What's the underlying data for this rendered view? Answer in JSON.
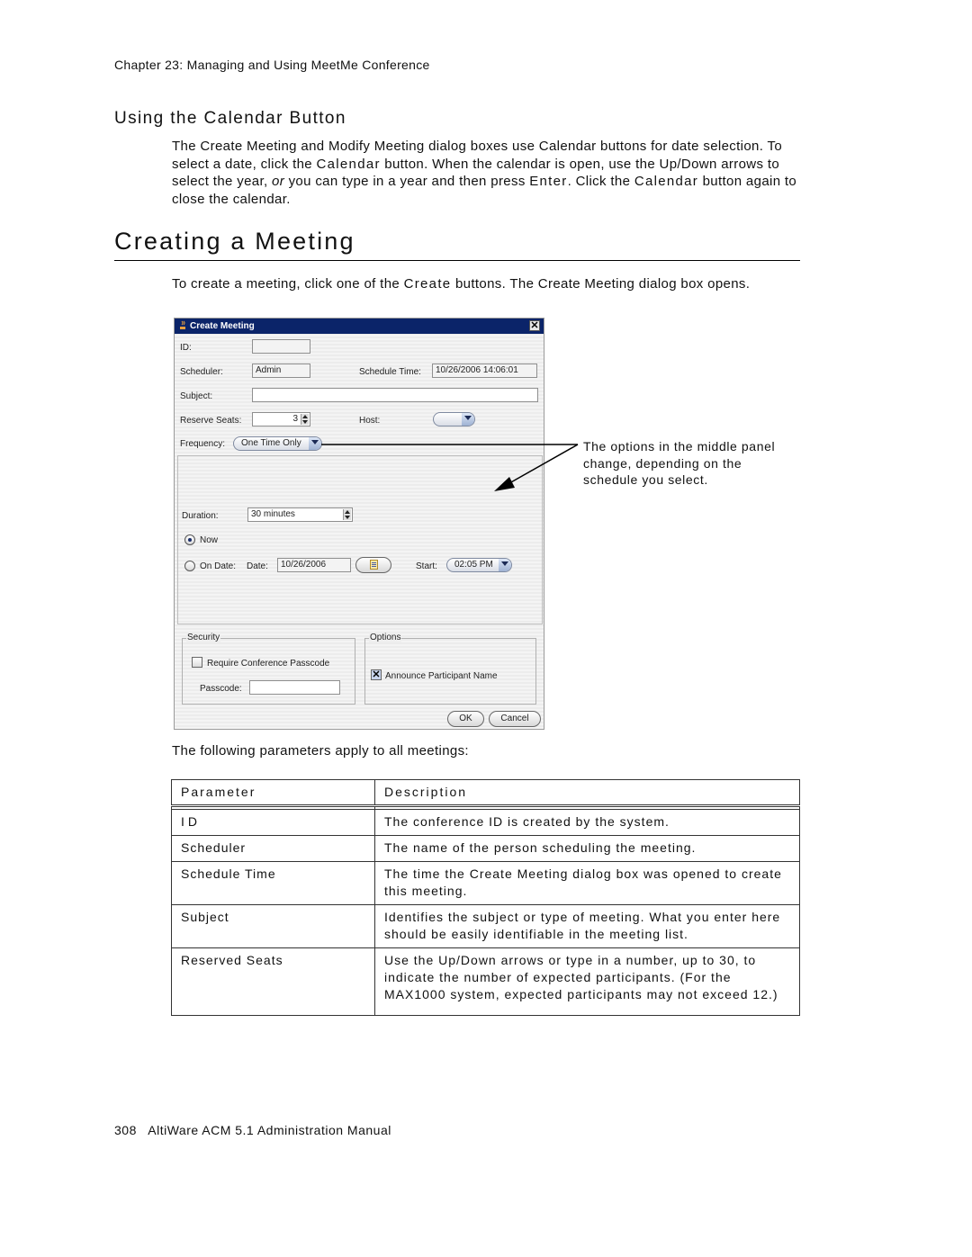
{
  "header": {
    "chapter": "Chapter 23:  Managing and Using MeetMe Conference"
  },
  "section_calendar": {
    "title": "Using the Calendar Button",
    "paragraph": [
      {
        "text": "The Create Meeting and Modify Meeting dialog boxes use Calendar buttons for date selection. To select a date, click the "
      },
      {
        "text": "Calendar",
        "style": "code"
      },
      {
        "text": " button. When the calendar is open, use the Up/Down arrows to select the year, "
      },
      {
        "text": "or",
        "style": "italic"
      },
      {
        "text": " you can type in a year and then press "
      },
      {
        "text": "Enter",
        "style": "code"
      },
      {
        "text": ". Click the "
      },
      {
        "text": "Calendar",
        "style": "code"
      },
      {
        "text": " button again to close the calendar."
      }
    ]
  },
  "section_create": {
    "title": "Creating a Meeting",
    "intro": [
      {
        "text": "To create a meeting, click one of the "
      },
      {
        "text": "Create",
        "style": "code"
      },
      {
        "text": " buttons. The Create Meeting dialog box opens."
      }
    ],
    "callout": "The options in the middle panel change, depending on the schedule you select.",
    "table_intro": "The following parameters apply to all meetings:"
  },
  "dialog": {
    "title": "Create Meeting",
    "close_glyph": "✕",
    "id_label": "ID:",
    "id_value": "",
    "scheduler_label": "Scheduler:",
    "scheduler_value": "Admin",
    "schedule_time_label": "Schedule Time:",
    "schedule_time_value": "10/26/2006 14:06:01",
    "subject_label": "Subject:",
    "subject_value": "",
    "reserve_seats_label": "Reserve Seats:",
    "reserve_seats_value": "3",
    "host_label": "Host:",
    "host_value": "",
    "frequency_label": "Frequency:",
    "frequency_value": "One Time Only",
    "duration_label": "Duration:",
    "duration_value": "30 minutes",
    "now_label": "Now",
    "now_selected": true,
    "on_date_label": "On Date:",
    "date_label": "Date:",
    "date_value": "10/26/2006",
    "start_label": "Start:",
    "start_value": "02:05 PM",
    "security_legend": "Security",
    "require_passcode_label": "Require Conference Passcode",
    "require_passcode_checked": false,
    "passcode_label": "Passcode:",
    "passcode_value": "",
    "options_legend": "Options",
    "announce_label": "Announce Participant Name",
    "announce_checked": true,
    "check_glyph": "✕",
    "ok_label": "OK",
    "cancel_label": "Cancel"
  },
  "parameters_table": {
    "headers": [
      "Parameter",
      "Description"
    ],
    "rows": [
      {
        "parameter": "ID",
        "description": "The conference ID is created by the system."
      },
      {
        "parameter": "Scheduler",
        "description": "The name of the person scheduling the meeting."
      },
      {
        "parameter": "Schedule Time",
        "description": "The time the Create Meeting dialog box was opened to create this meeting."
      },
      {
        "parameter": "Subject",
        "description": "Identifies the subject or type of meeting. What you enter here should be easily identifiable in the meeting list."
      },
      {
        "parameter": "Reserved Seats",
        "description": "Use the Up/Down arrows or type in a number, up to 30, to indicate the number of expected participants. (For the MAX1000 system, expected participants may not exceed 12.)"
      }
    ]
  },
  "footer": {
    "page_number": "308",
    "manual_title": "AltiWare ACM 5.1 Administration Manual"
  }
}
